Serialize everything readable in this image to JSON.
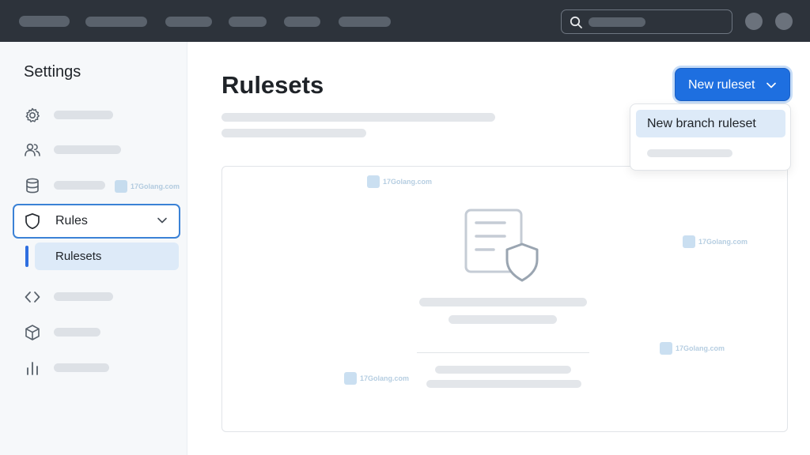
{
  "sidebar": {
    "title": "Settings",
    "items": [
      {
        "icon": "gear-icon"
      },
      {
        "icon": "people-icon"
      },
      {
        "icon": "database-icon"
      },
      {
        "icon": "shield-icon",
        "label": "Rules"
      },
      {
        "icon": "code-icon"
      },
      {
        "icon": "package-icon"
      },
      {
        "icon": "graph-icon"
      }
    ],
    "subitem_label": "Rulesets"
  },
  "main": {
    "title": "Rulesets",
    "new_button_label": "New ruleset",
    "dropdown": {
      "items": [
        "New branch ruleset"
      ]
    }
  },
  "watermark": {
    "text": "17Golang.com"
  },
  "colors": {
    "topbar": "#2d333b",
    "accent": "#1e6fe0",
    "selected_bg": "#ddeaf8"
  }
}
